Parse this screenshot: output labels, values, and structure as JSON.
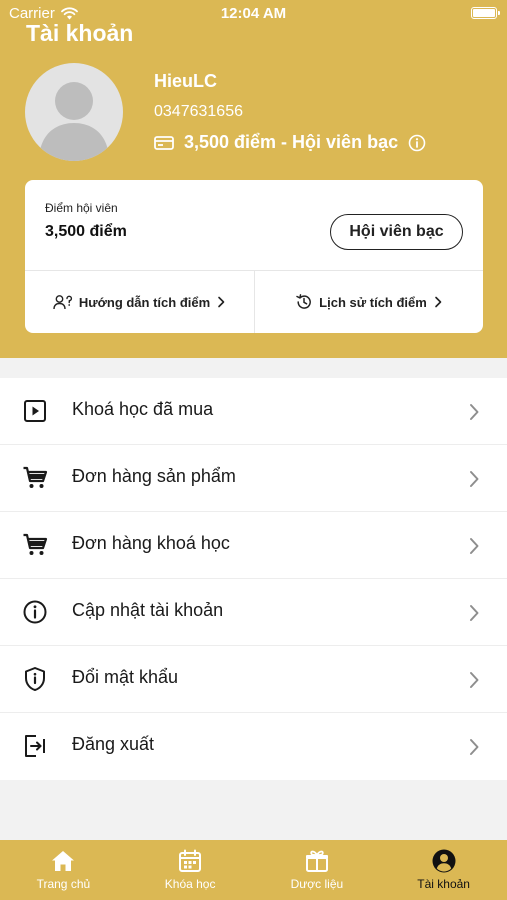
{
  "status_bar": {
    "carrier": "Carrier",
    "time": "12:04 AM"
  },
  "header": {
    "title": "Tài khoản"
  },
  "profile": {
    "name": "HieuLC",
    "phone": "0347631656",
    "points_summary": "3,500 điểm - Hội viên bạc"
  },
  "member_card": {
    "label": "Điểm hội viên",
    "points": "3,500 điểm",
    "tier_button": "Hội viên bạc",
    "guide_link": "Hướng dẫn tích điểm",
    "history_link": "Lịch sử tích điểm"
  },
  "menu": {
    "items": [
      {
        "label": "Khoá học đã mua",
        "icon": "play-square-icon"
      },
      {
        "label": "Đơn hàng sản phẩm",
        "icon": "cart-icon"
      },
      {
        "label": "Đơn hàng khoá học",
        "icon": "cart-icon"
      },
      {
        "label": "Cập nhật tài khoản",
        "icon": "info-icon"
      },
      {
        "label": "Đổi mật khẩu",
        "icon": "shield-icon"
      },
      {
        "label": "Đăng xuất",
        "icon": "logout-icon"
      }
    ]
  },
  "tab_bar": {
    "tabs": [
      {
        "label": "Trang chủ",
        "icon": "home-icon",
        "active": false
      },
      {
        "label": "Khóa học",
        "icon": "calendar-icon",
        "active": false
      },
      {
        "label": "Dược liệu",
        "icon": "gift-box-icon",
        "active": false
      },
      {
        "label": "Tài khoản",
        "icon": "user-circle-icon",
        "active": true
      }
    ]
  },
  "colors": {
    "brand": "#DBB854",
    "background": "#F2F2F2",
    "card": "#FFFFFF",
    "text": "#1A1A1A"
  }
}
